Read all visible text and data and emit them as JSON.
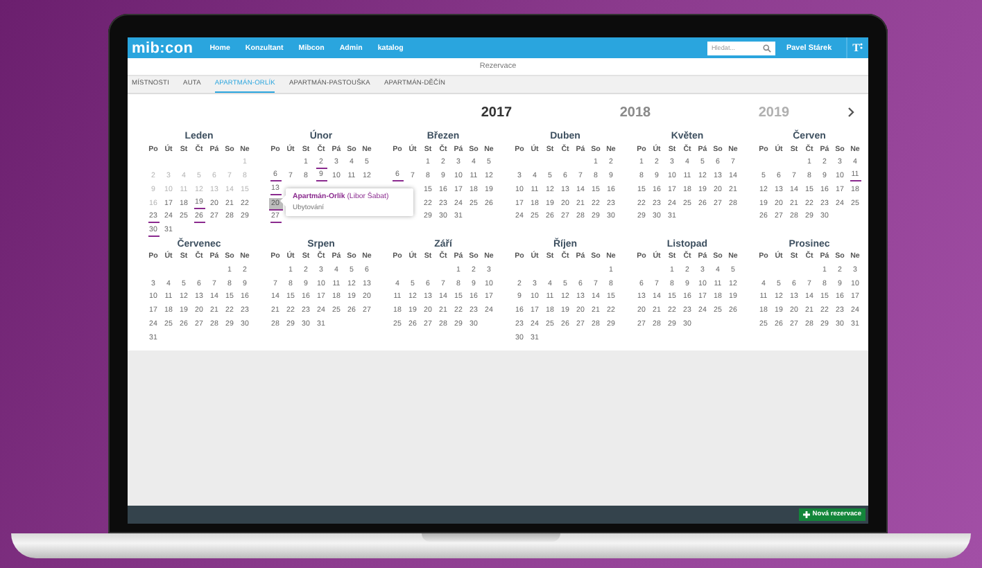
{
  "app": {
    "logo": "mib:con",
    "nav": [
      "Home",
      "Konzultant",
      "Mibcon",
      "Admin",
      "katalog"
    ],
    "search": {
      "placeholder": "Hledat..."
    },
    "user": "Pavel Stárek",
    "text_size_button": "T"
  },
  "page_title": "Rezervace",
  "tabs": [
    {
      "label": "MÍSTNOSTI",
      "selected": false
    },
    {
      "label": "AUTA",
      "selected": false
    },
    {
      "label": "APARTMÁN-ORLÍK",
      "selected": true
    },
    {
      "label": "APARTMÁN-PASTOUŠKA",
      "selected": false
    },
    {
      "label": "APARTMÁN-DĚČÍN",
      "selected": false
    }
  ],
  "years": [
    {
      "label": "2017",
      "selected": true
    },
    {
      "label": "2018",
      "selected": false
    },
    {
      "label": "2019",
      "selected": false
    }
  ],
  "calendar": {
    "months": [
      {
        "name": "Leden",
        "weekdays": [
          "Po",
          "Út",
          "St",
          "Čt",
          "Pá",
          "So",
          "Ne"
        ],
        "weeks": [
          [
            {
              "kind": "blank"
            },
            {
              "kind": "blank"
            },
            {
              "kind": "blank"
            },
            {
              "kind": "blank"
            },
            {
              "kind": "blank"
            },
            {
              "kind": "blank"
            },
            {
              "day": "1",
              "kind": "past"
            }
          ],
          [
            {
              "day": "2",
              "kind": "past"
            },
            {
              "day": "3",
              "kind": "past"
            },
            {
              "day": "4",
              "kind": "past"
            },
            {
              "day": "5",
              "kind": "past"
            },
            {
              "day": "6",
              "kind": "past"
            },
            {
              "day": "7",
              "kind": "past"
            },
            {
              "day": "8",
              "kind": "past"
            }
          ],
          [
            {
              "day": "9",
              "kind": "past"
            },
            {
              "day": "10",
              "kind": "past"
            },
            {
              "day": "11",
              "kind": "past"
            },
            {
              "day": "12",
              "kind": "past"
            },
            {
              "day": "13",
              "kind": "past"
            },
            {
              "day": "14",
              "kind": "past"
            },
            {
              "day": "15",
              "kind": "past"
            }
          ],
          [
            {
              "day": "16",
              "kind": "past"
            },
            {
              "day": "17",
              "kind": "free"
            },
            {
              "day": "18",
              "kind": "free"
            },
            {
              "day": "19",
              "kind": "booked"
            },
            {
              "day": "20",
              "kind": "free"
            },
            {
              "day": "21",
              "kind": "free"
            },
            {
              "day": "22",
              "kind": "free"
            }
          ],
          [
            {
              "day": "23",
              "kind": "booked"
            },
            {
              "day": "24",
              "kind": "free"
            },
            {
              "day": "25",
              "kind": "free"
            },
            {
              "day": "26",
              "kind": "booked"
            },
            {
              "day": "27",
              "kind": "free"
            },
            {
              "day": "28",
              "kind": "free"
            },
            {
              "day": "29",
              "kind": "free"
            }
          ],
          [
            {
              "day": "30",
              "kind": "booked"
            },
            {
              "day": "31",
              "kind": "free"
            }
          ]
        ]
      },
      {
        "name": "Únor",
        "weekdays": [
          "Po",
          "Út",
          "St",
          "Čt",
          "Pá",
          "So",
          "Ne"
        ],
        "weeks": [
          [
            {
              "kind": "blank"
            },
            {
              "kind": "blank"
            },
            {
              "day": "1",
              "kind": "free"
            },
            {
              "day": "2",
              "kind": "booked"
            },
            {
              "day": "3",
              "kind": "free"
            },
            {
              "day": "4",
              "kind": "free"
            },
            {
              "day": "5",
              "kind": "free"
            }
          ],
          [
            {
              "day": "6",
              "kind": "booked"
            },
            {
              "day": "7",
              "kind": "free"
            },
            {
              "day": "8",
              "kind": "free"
            },
            {
              "day": "9",
              "kind": "booked"
            },
            {
              "day": "10",
              "kind": "free"
            },
            {
              "day": "11",
              "kind": "free"
            },
            {
              "day": "12",
              "kind": "free"
            }
          ],
          [
            {
              "day": "13",
              "kind": "booked"
            }
          ],
          [
            {
              "day": "20",
              "kind": "selected"
            }
          ],
          [
            {
              "day": "27",
              "kind": "booked"
            }
          ]
        ]
      },
      {
        "name": "Březen",
        "weekdays": [
          "Po",
          "Út",
          "St",
          "Čt",
          "Pá",
          "So",
          "Ne"
        ],
        "weeks": [
          [
            {
              "kind": "blank"
            },
            {
              "kind": "blank"
            },
            {
              "day": "1",
              "kind": "free"
            },
            {
              "day": "2",
              "kind": "free"
            },
            {
              "day": "3",
              "kind": "free"
            },
            {
              "day": "4",
              "kind": "free"
            },
            {
              "day": "5",
              "kind": "free"
            }
          ],
          [
            {
              "day": "6",
              "kind": "booked"
            },
            {
              "day": "7",
              "kind": "free"
            },
            {
              "day": "8",
              "kind": "free"
            },
            {
              "day": "9",
              "kind": "free"
            },
            {
              "day": "10",
              "kind": "free"
            },
            {
              "day": "11",
              "kind": "free"
            },
            {
              "day": "12",
              "kind": "free"
            }
          ],
          [
            {
              "kind": "blank"
            },
            {
              "kind": "blank"
            },
            {
              "day": "15",
              "kind": "free"
            },
            {
              "day": "16",
              "kind": "free"
            },
            {
              "day": "17",
              "kind": "free"
            },
            {
              "day": "18",
              "kind": "free"
            },
            {
              "day": "19",
              "kind": "free"
            }
          ],
          [
            {
              "kind": "blank"
            },
            {
              "kind": "blank"
            },
            {
              "day": "22",
              "kind": "free"
            },
            {
              "day": "23",
              "kind": "free"
            },
            {
              "day": "24",
              "kind": "free"
            },
            {
              "day": "25",
              "kind": "free"
            },
            {
              "day": "26",
              "kind": "free"
            }
          ],
          [
            {
              "kind": "blank"
            },
            {
              "kind": "blank"
            },
            {
              "day": "29",
              "kind": "free"
            },
            {
              "day": "30",
              "kind": "free"
            },
            {
              "day": "31",
              "kind": "free"
            }
          ]
        ]
      },
      {
        "name": "Duben",
        "weekdays": [
          "Po",
          "Út",
          "St",
          "Čt",
          "Pá",
          "So",
          "Ne"
        ],
        "weeks": [
          [
            {
              "kind": "blank"
            },
            {
              "kind": "blank"
            },
            {
              "kind": "blank"
            },
            {
              "kind": "blank"
            },
            {
              "kind": "blank"
            },
            {
              "day": "1",
              "kind": "free"
            },
            {
              "day": "2",
              "kind": "free"
            }
          ],
          [
            {
              "day": "3",
              "kind": "free"
            },
            {
              "day": "4",
              "kind": "free"
            },
            {
              "day": "5",
              "kind": "free"
            },
            {
              "day": "6",
              "kind": "free"
            },
            {
              "day": "7",
              "kind": "free"
            },
            {
              "day": "8",
              "kind": "free"
            },
            {
              "day": "9",
              "kind": "free"
            }
          ],
          [
            {
              "day": "10",
              "kind": "free"
            },
            {
              "day": "11",
              "kind": "free"
            },
            {
              "day": "12",
              "kind": "free"
            },
            {
              "day": "13",
              "kind": "free"
            },
            {
              "day": "14",
              "kind": "free"
            },
            {
              "day": "15",
              "kind": "free"
            },
            {
              "day": "16",
              "kind": "free"
            }
          ],
          [
            {
              "day": "17",
              "kind": "free"
            },
            {
              "day": "18",
              "kind": "free"
            },
            {
              "day": "19",
              "kind": "free"
            },
            {
              "day": "20",
              "kind": "free"
            },
            {
              "day": "21",
              "kind": "free"
            },
            {
              "day": "22",
              "kind": "free"
            },
            {
              "day": "23",
              "kind": "free"
            }
          ],
          [
            {
              "day": "24",
              "kind": "free"
            },
            {
              "day": "25",
              "kind": "free"
            },
            {
              "day": "26",
              "kind": "free"
            },
            {
              "day": "27",
              "kind": "free"
            },
            {
              "day": "28",
              "kind": "free"
            },
            {
              "day": "29",
              "kind": "free"
            },
            {
              "day": "30",
              "kind": "free"
            }
          ]
        ]
      },
      {
        "name": "Květen",
        "weekdays": [
          "Po",
          "Út",
          "St",
          "Čt",
          "Pá",
          "So",
          "Ne"
        ],
        "weeks": [
          [
            {
              "day": "1",
              "kind": "free"
            },
            {
              "day": "2",
              "kind": "free"
            },
            {
              "day": "3",
              "kind": "free"
            },
            {
              "day": "4",
              "kind": "free"
            },
            {
              "day": "5",
              "kind": "free"
            },
            {
              "day": "6",
              "kind": "free"
            },
            {
              "day": "7",
              "kind": "free"
            }
          ],
          [
            {
              "day": "8",
              "kind": "free"
            },
            {
              "day": "9",
              "kind": "free"
            },
            {
              "day": "10",
              "kind": "free"
            },
            {
              "day": "11",
              "kind": "free"
            },
            {
              "day": "12",
              "kind": "free"
            },
            {
              "day": "13",
              "kind": "free"
            },
            {
              "day": "14",
              "kind": "free"
            }
          ],
          [
            {
              "day": "15",
              "kind": "free"
            },
            {
              "day": "16",
              "kind": "free"
            },
            {
              "day": "17",
              "kind": "free"
            },
            {
              "day": "18",
              "kind": "free"
            },
            {
              "day": "19",
              "kind": "free"
            },
            {
              "day": "20",
              "kind": "free"
            },
            {
              "day": "21",
              "kind": "free"
            }
          ],
          [
            {
              "day": "22",
              "kind": "free"
            },
            {
              "day": "23",
              "kind": "free"
            },
            {
              "day": "24",
              "kind": "free"
            },
            {
              "day": "25",
              "kind": "free"
            },
            {
              "day": "26",
              "kind": "free"
            },
            {
              "day": "27",
              "kind": "free"
            },
            {
              "day": "28",
              "kind": "free"
            }
          ],
          [
            {
              "day": "29",
              "kind": "free"
            },
            {
              "day": "30",
              "kind": "free"
            },
            {
              "day": "31",
              "kind": "free"
            }
          ]
        ]
      },
      {
        "name": "Červen",
        "weekdays": [
          "Po",
          "Út",
          "St",
          "Čt",
          "Pá",
          "So",
          "Ne"
        ],
        "weeks": [
          [
            {
              "kind": "blank"
            },
            {
              "kind": "blank"
            },
            {
              "kind": "blank"
            },
            {
              "day": "1",
              "kind": "free"
            },
            {
              "day": "2",
              "kind": "free"
            },
            {
              "day": "3",
              "kind": "free"
            },
            {
              "day": "4",
              "kind": "free"
            }
          ],
          [
            {
              "day": "5",
              "kind": "free"
            },
            {
              "day": "6",
              "kind": "free"
            },
            {
              "day": "7",
              "kind": "free"
            },
            {
              "day": "8",
              "kind": "free"
            },
            {
              "day": "9",
              "kind": "free"
            },
            {
              "day": "10",
              "kind": "free"
            },
            {
              "day": "11",
              "kind": "booked"
            }
          ],
          [
            {
              "day": "12",
              "kind": "free"
            },
            {
              "day": "13",
              "kind": "free"
            },
            {
              "day": "14",
              "kind": "free"
            },
            {
              "day": "15",
              "kind": "free"
            },
            {
              "day": "16",
              "kind": "free"
            },
            {
              "day": "17",
              "kind": "free"
            },
            {
              "day": "18",
              "kind": "free"
            }
          ],
          [
            {
              "day": "19",
              "kind": "free"
            },
            {
              "day": "20",
              "kind": "free"
            },
            {
              "day": "21",
              "kind": "free"
            },
            {
              "day": "22",
              "kind": "free"
            },
            {
              "day": "23",
              "kind": "free"
            },
            {
              "day": "24",
              "kind": "free"
            },
            {
              "day": "25",
              "kind": "free"
            }
          ],
          [
            {
              "day": "26",
              "kind": "free"
            },
            {
              "day": "27",
              "kind": "free"
            },
            {
              "day": "28",
              "kind": "free"
            },
            {
              "day": "29",
              "kind": "free"
            },
            {
              "day": "30",
              "kind": "free"
            }
          ]
        ]
      },
      {
        "name": "Červenec",
        "weekdays": [
          "Po",
          "Út",
          "St",
          "Čt",
          "Pá",
          "So",
          "Ne"
        ],
        "weeks": [
          [
            {
              "kind": "blank"
            },
            {
              "kind": "blank"
            },
            {
              "kind": "blank"
            },
            {
              "kind": "blank"
            },
            {
              "kind": "blank"
            },
            {
              "day": "1",
              "kind": "free"
            },
            {
              "day": "2",
              "kind": "free"
            }
          ],
          [
            {
              "day": "3",
              "kind": "free"
            },
            {
              "day": "4",
              "kind": "free"
            },
            {
              "day": "5",
              "kind": "free"
            },
            {
              "day": "6",
              "kind": "free"
            },
            {
              "day": "7",
              "kind": "free"
            },
            {
              "day": "8",
              "kind": "free"
            },
            {
              "day": "9",
              "kind": "free"
            }
          ],
          [
            {
              "day": "10",
              "kind": "free"
            },
            {
              "day": "11",
              "kind": "free"
            },
            {
              "day": "12",
              "kind": "free"
            },
            {
              "day": "13",
              "kind": "free"
            },
            {
              "day": "14",
              "kind": "free"
            },
            {
              "day": "15",
              "kind": "free"
            },
            {
              "day": "16",
              "kind": "free"
            }
          ],
          [
            {
              "day": "17",
              "kind": "free"
            },
            {
              "day": "18",
              "kind": "free"
            },
            {
              "day": "19",
              "kind": "free"
            },
            {
              "day": "20",
              "kind": "free"
            },
            {
              "day": "21",
              "kind": "free"
            },
            {
              "day": "22",
              "kind": "free"
            },
            {
              "day": "23",
              "kind": "free"
            }
          ],
          [
            {
              "day": "24",
              "kind": "free"
            },
            {
              "day": "25",
              "kind": "free"
            },
            {
              "day": "26",
              "kind": "free"
            },
            {
              "day": "27",
              "kind": "free"
            },
            {
              "day": "28",
              "kind": "free"
            },
            {
              "day": "29",
              "kind": "free"
            },
            {
              "day": "30",
              "kind": "free"
            }
          ],
          [
            {
              "day": "31",
              "kind": "free"
            }
          ]
        ]
      },
      {
        "name": "Srpen",
        "weekdays": [
          "Po",
          "Út",
          "St",
          "Čt",
          "Pá",
          "So",
          "Ne"
        ],
        "weeks": [
          [
            {
              "kind": "blank"
            },
            {
              "day": "1",
              "kind": "free"
            },
            {
              "day": "2",
              "kind": "free"
            },
            {
              "day": "3",
              "kind": "free"
            },
            {
              "day": "4",
              "kind": "free"
            },
            {
              "day": "5",
              "kind": "free"
            },
            {
              "day": "6",
              "kind": "free"
            }
          ],
          [
            {
              "day": "7",
              "kind": "free"
            },
            {
              "day": "8",
              "kind": "free"
            },
            {
              "day": "9",
              "kind": "free"
            },
            {
              "day": "10",
              "kind": "free"
            },
            {
              "day": "11",
              "kind": "free"
            },
            {
              "day": "12",
              "kind": "free"
            },
            {
              "day": "13",
              "kind": "free"
            }
          ],
          [
            {
              "day": "14",
              "kind": "free"
            },
            {
              "day": "15",
              "kind": "free"
            },
            {
              "day": "16",
              "kind": "free"
            },
            {
              "day": "17",
              "kind": "free"
            },
            {
              "day": "18",
              "kind": "free"
            },
            {
              "day": "19",
              "kind": "free"
            },
            {
              "day": "20",
              "kind": "free"
            }
          ],
          [
            {
              "day": "21",
              "kind": "free"
            },
            {
              "day": "22",
              "kind": "free"
            },
            {
              "day": "23",
              "kind": "free"
            },
            {
              "day": "24",
              "kind": "free"
            },
            {
              "day": "25",
              "kind": "free"
            },
            {
              "day": "26",
              "kind": "free"
            },
            {
              "day": "27",
              "kind": "free"
            }
          ],
          [
            {
              "day": "28",
              "kind": "free"
            },
            {
              "day": "29",
              "kind": "free"
            },
            {
              "day": "30",
              "kind": "free"
            },
            {
              "day": "31",
              "kind": "free"
            }
          ]
        ]
      },
      {
        "name": "Září",
        "weekdays": [
          "Po",
          "Út",
          "St",
          "Čt",
          "Pá",
          "So",
          "Ne"
        ],
        "weeks": [
          [
            {
              "kind": "blank"
            },
            {
              "kind": "blank"
            },
            {
              "kind": "blank"
            },
            {
              "kind": "blank"
            },
            {
              "day": "1",
              "kind": "free"
            },
            {
              "day": "2",
              "kind": "free"
            },
            {
              "day": "3",
              "kind": "free"
            }
          ],
          [
            {
              "day": "4",
              "kind": "free"
            },
            {
              "day": "5",
              "kind": "free"
            },
            {
              "day": "6",
              "kind": "free"
            },
            {
              "day": "7",
              "kind": "free"
            },
            {
              "day": "8",
              "kind": "free"
            },
            {
              "day": "9",
              "kind": "free"
            },
            {
              "day": "10",
              "kind": "free"
            }
          ],
          [
            {
              "day": "11",
              "kind": "free"
            },
            {
              "day": "12",
              "kind": "free"
            },
            {
              "day": "13",
              "kind": "free"
            },
            {
              "day": "14",
              "kind": "free"
            },
            {
              "day": "15",
              "kind": "free"
            },
            {
              "day": "16",
              "kind": "free"
            },
            {
              "day": "17",
              "kind": "free"
            }
          ],
          [
            {
              "day": "18",
              "kind": "free"
            },
            {
              "day": "19",
              "kind": "free"
            },
            {
              "day": "20",
              "kind": "free"
            },
            {
              "day": "21",
              "kind": "free"
            },
            {
              "day": "22",
              "kind": "free"
            },
            {
              "day": "23",
              "kind": "free"
            },
            {
              "day": "24",
              "kind": "free"
            }
          ],
          [
            {
              "day": "25",
              "kind": "free"
            },
            {
              "day": "26",
              "kind": "free"
            },
            {
              "day": "27",
              "kind": "free"
            },
            {
              "day": "28",
              "kind": "free"
            },
            {
              "day": "29",
              "kind": "free"
            },
            {
              "day": "30",
              "kind": "free"
            }
          ]
        ]
      },
      {
        "name": "Říjen",
        "weekdays": [
          "Po",
          "Út",
          "St",
          "Čt",
          "Pá",
          "So",
          "Ne"
        ],
        "weeks": [
          [
            {
              "kind": "blank"
            },
            {
              "kind": "blank"
            },
            {
              "kind": "blank"
            },
            {
              "kind": "blank"
            },
            {
              "kind": "blank"
            },
            {
              "kind": "blank"
            },
            {
              "day": "1",
              "kind": "free"
            }
          ],
          [
            {
              "day": "2",
              "kind": "free"
            },
            {
              "day": "3",
              "kind": "free"
            },
            {
              "day": "4",
              "kind": "free"
            },
            {
              "day": "5",
              "kind": "free"
            },
            {
              "day": "6",
              "kind": "free"
            },
            {
              "day": "7",
              "kind": "free"
            },
            {
              "day": "8",
              "kind": "free"
            }
          ],
          [
            {
              "day": "9",
              "kind": "free"
            },
            {
              "day": "10",
              "kind": "free"
            },
            {
              "day": "11",
              "kind": "free"
            },
            {
              "day": "12",
              "kind": "free"
            },
            {
              "day": "13",
              "kind": "free"
            },
            {
              "day": "14",
              "kind": "free"
            },
            {
              "day": "15",
              "kind": "free"
            }
          ],
          [
            {
              "day": "16",
              "kind": "free"
            },
            {
              "day": "17",
              "kind": "free"
            },
            {
              "day": "18",
              "kind": "free"
            },
            {
              "day": "19",
              "kind": "free"
            },
            {
              "day": "20",
              "kind": "free"
            },
            {
              "day": "21",
              "kind": "free"
            },
            {
              "day": "22",
              "kind": "free"
            }
          ],
          [
            {
              "day": "23",
              "kind": "free"
            },
            {
              "day": "24",
              "kind": "free"
            },
            {
              "day": "25",
              "kind": "free"
            },
            {
              "day": "26",
              "kind": "free"
            },
            {
              "day": "27",
              "kind": "free"
            },
            {
              "day": "28",
              "kind": "free"
            },
            {
              "day": "29",
              "kind": "free"
            }
          ],
          [
            {
              "day": "30",
              "kind": "free"
            },
            {
              "day": "31",
              "kind": "free"
            }
          ]
        ]
      },
      {
        "name": "Listopad",
        "weekdays": [
          "Po",
          "Út",
          "St",
          "Čt",
          "Pá",
          "So",
          "Ne"
        ],
        "weeks": [
          [
            {
              "kind": "blank"
            },
            {
              "kind": "blank"
            },
            {
              "day": "1",
              "kind": "free"
            },
            {
              "day": "2",
              "kind": "free"
            },
            {
              "day": "3",
              "kind": "free"
            },
            {
              "day": "4",
              "kind": "free"
            },
            {
              "day": "5",
              "kind": "free"
            }
          ],
          [
            {
              "day": "6",
              "kind": "free"
            },
            {
              "day": "7",
              "kind": "free"
            },
            {
              "day": "8",
              "kind": "free"
            },
            {
              "day": "9",
              "kind": "free"
            },
            {
              "day": "10",
              "kind": "free"
            },
            {
              "day": "11",
              "kind": "free"
            },
            {
              "day": "12",
              "kind": "free"
            }
          ],
          [
            {
              "day": "13",
              "kind": "free"
            },
            {
              "day": "14",
              "kind": "free"
            },
            {
              "day": "15",
              "kind": "free"
            },
            {
              "day": "16",
              "kind": "free"
            },
            {
              "day": "17",
              "kind": "free"
            },
            {
              "day": "18",
              "kind": "free"
            },
            {
              "day": "19",
              "kind": "free"
            }
          ],
          [
            {
              "day": "20",
              "kind": "free"
            },
            {
              "day": "21",
              "kind": "free"
            },
            {
              "day": "22",
              "kind": "free"
            },
            {
              "day": "23",
              "kind": "free"
            },
            {
              "day": "24",
              "kind": "free"
            },
            {
              "day": "25",
              "kind": "free"
            },
            {
              "day": "26",
              "kind": "free"
            }
          ],
          [
            {
              "day": "27",
              "kind": "free"
            },
            {
              "day": "28",
              "kind": "free"
            },
            {
              "day": "29",
              "kind": "free"
            },
            {
              "day": "30",
              "kind": "free"
            }
          ]
        ]
      },
      {
        "name": "Prosinec",
        "weekdays": [
          "Po",
          "Út",
          "St",
          "Čt",
          "Pá",
          "So",
          "Ne"
        ],
        "weeks": [
          [
            {
              "kind": "blank"
            },
            {
              "kind": "blank"
            },
            {
              "kind": "blank"
            },
            {
              "kind": "blank"
            },
            {
              "day": "1",
              "kind": "free"
            },
            {
              "day": "2",
              "kind": "free"
            },
            {
              "day": "3",
              "kind": "free"
            }
          ],
          [
            {
              "day": "4",
              "kind": "free"
            },
            {
              "day": "5",
              "kind": "free"
            },
            {
              "day": "6",
              "kind": "free"
            },
            {
              "day": "7",
              "kind": "free"
            },
            {
              "day": "8",
              "kind": "free"
            },
            {
              "day": "9",
              "kind": "free"
            },
            {
              "day": "10",
              "kind": "free"
            }
          ],
          [
            {
              "day": "11",
              "kind": "free"
            },
            {
              "day": "12",
              "kind": "free"
            },
            {
              "day": "13",
              "kind": "free"
            },
            {
              "day": "14",
              "kind": "free"
            },
            {
              "day": "15",
              "kind": "free"
            },
            {
              "day": "16",
              "kind": "free"
            },
            {
              "day": "17",
              "kind": "free"
            }
          ],
          [
            {
              "day": "18",
              "kind": "free"
            },
            {
              "day": "19",
              "kind": "free"
            },
            {
              "day": "20",
              "kind": "free"
            },
            {
              "day": "21",
              "kind": "free"
            },
            {
              "day": "22",
              "kind": "free"
            },
            {
              "day": "23",
              "kind": "free"
            },
            {
              "day": "24",
              "kind": "free"
            }
          ],
          [
            {
              "day": "25",
              "kind": "free"
            },
            {
              "day": "26",
              "kind": "free"
            },
            {
              "day": "27",
              "kind": "free"
            },
            {
              "day": "28",
              "kind": "free"
            },
            {
              "day": "29",
              "kind": "free"
            },
            {
              "day": "30",
              "kind": "free"
            },
            {
              "day": "31",
              "kind": "free"
            }
          ]
        ]
      }
    ]
  },
  "tooltip": {
    "title": "Apartmán-Orlík",
    "guest": "(Libor Šabat)",
    "type": "Ubytování"
  },
  "footer": {
    "button": "Nová rezervace"
  }
}
